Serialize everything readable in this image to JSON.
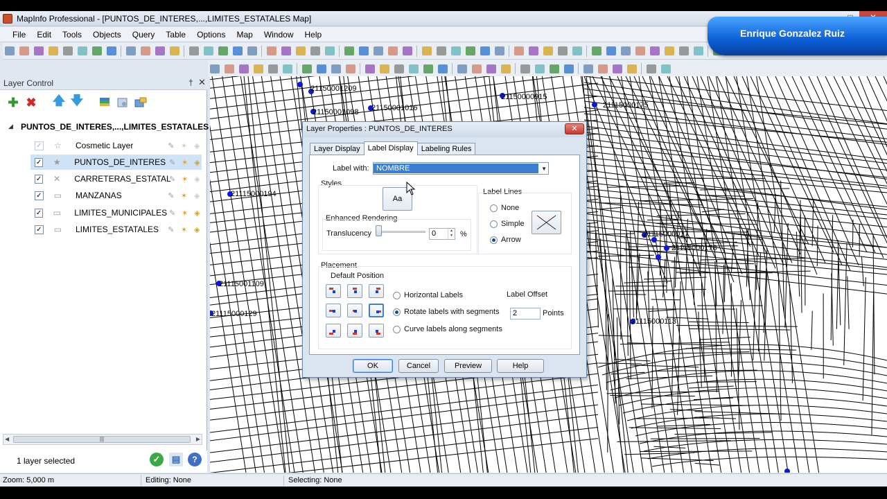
{
  "window": {
    "title": "MapInfo Professional - [PUNTOS_DE_INTERES,...,LIMITES_ESTATALES Map]"
  },
  "banner": {
    "text": "Enrique Gonzalez Ruiz"
  },
  "menu": [
    "File",
    "Edit",
    "Tools",
    "Objects",
    "Query",
    "Table",
    "Options",
    "Map",
    "Window",
    "Help"
  ],
  "layer_control": {
    "title": "Layer Control",
    "root_label": "PUNTOS_DE_INTERES,...,LIMITES_ESTATALES Map",
    "layers": [
      {
        "name": "Cosmetic Layer",
        "checked": true,
        "dim": true
      },
      {
        "name": "PUNTOS_DE_INTERES",
        "checked": true,
        "selected": true
      },
      {
        "name": "CARRETERAS_ESTATAL",
        "checked": true
      },
      {
        "name": "MANZANAS",
        "checked": true
      },
      {
        "name": "LIMITES_MUNICIPALES",
        "checked": true
      },
      {
        "name": "LIMITES_ESTATALES",
        "checked": true
      }
    ],
    "footer_text": "1 layer selected"
  },
  "map_labels": [
    "21150001209",
    "21150001098",
    "21150001016",
    "21115000194",
    "21150000915",
    "21115000175",
    "21115001109",
    "21115000129",
    "21115000017",
    "21115000178",
    "21115000113"
  ],
  "status": {
    "zoom": "Zoom: 5,000 m",
    "editing": "Editing: None",
    "selecting": "Selecting: None"
  },
  "dialog": {
    "title": "Layer Properties : PUNTOS_DE_INTERES",
    "close": "✕",
    "tabs": [
      "Layer Display",
      "Label Display",
      "Labeling Rules"
    ],
    "label_with_caption": "Label with:",
    "label_with_value": "NOMBRE",
    "styles_caption": "Styles",
    "style_button": "Aa",
    "enhanced_caption": "Enhanced Rendering",
    "translucency_caption": "Translucency",
    "translucency_value": "0",
    "translucency_unit": "%",
    "label_lines_caption": "Label Lines",
    "label_lines_options": [
      "None",
      "Simple",
      "Arrow"
    ],
    "label_lines_selected": "Arrow",
    "placement_caption": "Placement",
    "default_position_caption": "Default Position",
    "orientation_options": [
      "Horizontal Labels",
      "Rotate labels with segments",
      "Curve labels along segments"
    ],
    "orientation_selected": "Rotate labels with segments",
    "label_offset_caption": "Label Offset",
    "label_offset_value": "2",
    "label_offset_unit": "Points",
    "buttons": [
      "OK",
      "Cancel",
      "Preview",
      "Help"
    ]
  }
}
